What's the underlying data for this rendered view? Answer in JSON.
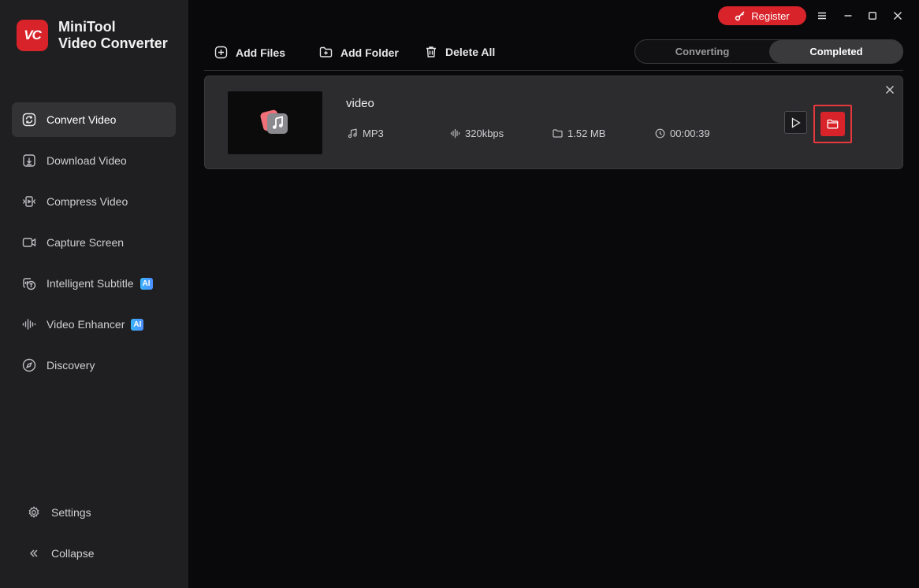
{
  "app": {
    "name_line1": "MiniTool",
    "name_line2": "Video Converter",
    "logo_text": "VC",
    "brand_color": "#d8232a"
  },
  "sidebar": {
    "items": [
      {
        "label": "Convert Video",
        "icon": "convert-icon",
        "active": true
      },
      {
        "label": "Download Video",
        "icon": "download-icon"
      },
      {
        "label": "Compress Video",
        "icon": "compress-icon"
      },
      {
        "label": "Capture Screen",
        "icon": "camera-icon"
      },
      {
        "label": "Intelligent Subtitle",
        "icon": "subtitle-icon",
        "badge": "AI"
      },
      {
        "label": "Video Enhancer",
        "icon": "enhancer-icon",
        "badge": "AI"
      },
      {
        "label": "Discovery",
        "icon": "compass-icon"
      }
    ],
    "settings_label": "Settings",
    "collapse_label": "Collapse"
  },
  "titlebar": {
    "register_label": "Register"
  },
  "toolbar": {
    "add_files": "Add Files",
    "add_folder": "Add Folder",
    "delete_all": "Delete All"
  },
  "tabs": {
    "converting": "Converting",
    "completed": "Completed",
    "active": "Completed"
  },
  "file": {
    "name": "video",
    "format": "MP3",
    "bitrate": "320kbps",
    "size": "1.52 MB",
    "duration": "00:00:39"
  }
}
